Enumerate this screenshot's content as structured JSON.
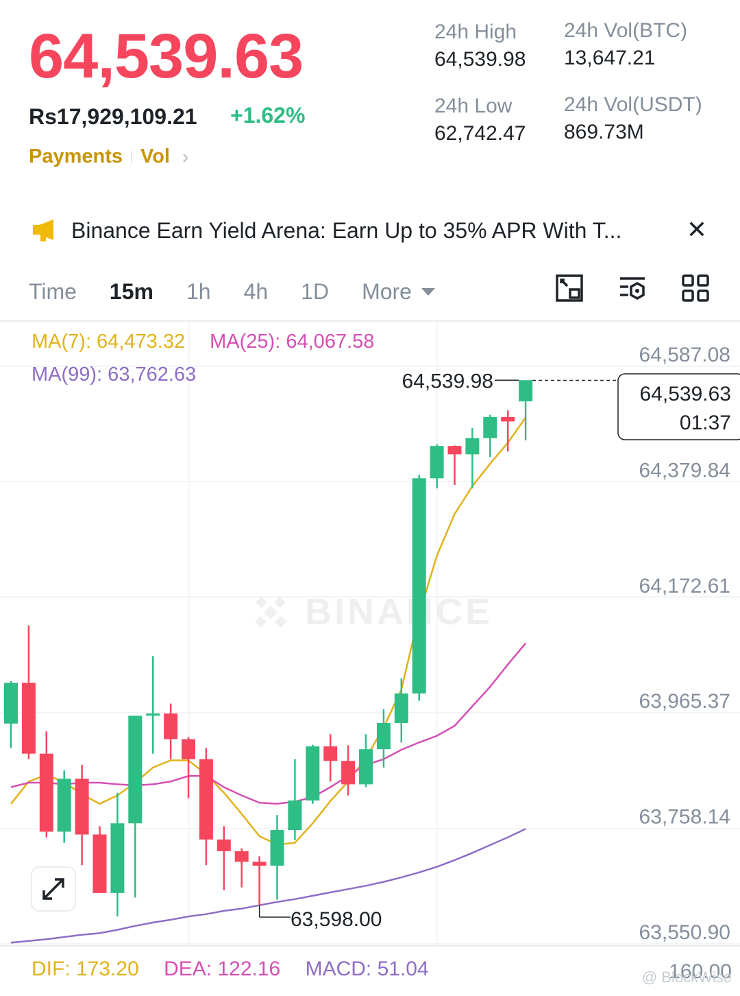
{
  "header": {
    "last_price": "64,539.63",
    "fiat_price": "Rs17,929,109.21",
    "change_pct": "+1.62%",
    "links": [
      "Payments",
      "Vol"
    ],
    "stats": [
      {
        "label": "24h High",
        "value": "64,539.98"
      },
      {
        "label": "24h Vol(BTC)",
        "value": "13,647.21"
      },
      {
        "label": "24h Low",
        "value": "62,742.47"
      },
      {
        "label": "24h Vol(USDT)",
        "value": "869.73M"
      }
    ]
  },
  "banner": {
    "text": "Binance Earn Yield Arena: Earn Up to 35% APR With T...",
    "icon": "megaphone-icon"
  },
  "timeframes": {
    "items": [
      "Time",
      "15m",
      "1h",
      "4h",
      "1D"
    ],
    "active": "15m",
    "more_label": "More"
  },
  "indicators": {
    "ma7": "MA(7): 64,473.32",
    "ma25": "MA(25): 64,067.58",
    "ma99": "MA(99): 63,762.63"
  },
  "chart_data": {
    "type": "candlestick",
    "interval": "15m",
    "y_ticks": [
      64587.08,
      64379.84,
      64172.61,
      63965.37,
      63758.14,
      63550.9
    ],
    "y_tick_labels": [
      "64,587.08",
      "64,379.84",
      "64,172.61",
      "63,965.37",
      "63,758.14",
      "63,550.90"
    ],
    "ylim": [
      63520,
      64650
    ],
    "grid": true,
    "current_price": "64,539.63",
    "countdown": "01:37",
    "high_marker": {
      "label": "64,539.98",
      "value": 64539.98
    },
    "low_marker": {
      "label": "63,598.00",
      "value": 63598.0
    },
    "candles": [
      {
        "open": 63924,
        "close": 63997,
        "high": 64000,
        "low": 63880
      },
      {
        "open": 63997,
        "close": 63870,
        "high": 64100,
        "low": 63860
      },
      {
        "open": 63870,
        "close": 63730,
        "high": 63910,
        "low": 63720
      },
      {
        "open": 63730,
        "close": 63825,
        "high": 63840,
        "low": 63710
      },
      {
        "open": 63825,
        "close": 63725,
        "high": 63850,
        "low": 63670
      },
      {
        "open": 63725,
        "close": 63620,
        "high": 63740,
        "low": 63620
      },
      {
        "open": 63620,
        "close": 63745,
        "high": 63800,
        "low": 63578
      },
      {
        "open": 63745,
        "close": 63938,
        "high": 63938,
        "low": 63612
      },
      {
        "open": 63938,
        "close": 63942,
        "high": 64045,
        "low": 63870
      },
      {
        "open": 63942,
        "close": 63896,
        "high": 63960,
        "low": 63860
      },
      {
        "open": 63896,
        "close": 63860,
        "high": 63900,
        "low": 63790
      },
      {
        "open": 63860,
        "close": 63716,
        "high": 63880,
        "low": 63670
      },
      {
        "open": 63716,
        "close": 63695,
        "high": 63740,
        "low": 63625
      },
      {
        "open": 63695,
        "close": 63676,
        "high": 63700,
        "low": 63630
      },
      {
        "open": 63676,
        "close": 63669,
        "high": 63686,
        "low": 63598
      },
      {
        "open": 63669,
        "close": 63733,
        "high": 63760,
        "low": 63608
      },
      {
        "open": 63733,
        "close": 63786,
        "high": 63860,
        "low": 63715
      },
      {
        "open": 63786,
        "close": 63883,
        "high": 63886,
        "low": 63780
      },
      {
        "open": 63883,
        "close": 63857,
        "high": 63905,
        "low": 63820
      },
      {
        "open": 63857,
        "close": 63815,
        "high": 63885,
        "low": 63795
      },
      {
        "open": 63815,
        "close": 63878,
        "high": 63905,
        "low": 63810
      },
      {
        "open": 63878,
        "close": 63925,
        "high": 63950,
        "low": 63845
      },
      {
        "open": 63925,
        "close": 63978,
        "high": 64005,
        "low": 63890
      },
      {
        "open": 63978,
        "close": 64364,
        "high": 64370,
        "low": 63965
      },
      {
        "open": 64364,
        "close": 64422,
        "high": 64425,
        "low": 64346
      },
      {
        "open": 64422,
        "close": 64407,
        "high": 64423,
        "low": 64352
      },
      {
        "open": 64407,
        "close": 64436,
        "high": 64454,
        "low": 64346
      },
      {
        "open": 64436,
        "close": 64474,
        "high": 64478,
        "low": 64402
      },
      {
        "open": 64474,
        "close": 64466,
        "high": 64486,
        "low": 64412
      },
      {
        "open": 64502,
        "close": 64540,
        "high": 64540,
        "low": 64432
      }
    ],
    "series": [
      {
        "name": "MA(7)",
        "color": "#e0b21b",
        "values": [
          63780,
          63820,
          63832,
          63819,
          63797,
          63780,
          63795,
          63818,
          63845,
          63858,
          63858,
          63833,
          63800,
          63762,
          63722,
          63707,
          63710,
          63745,
          63785,
          63820,
          63862,
          63917,
          63985,
          64120,
          64225,
          64300,
          64350,
          64390,
          64428,
          64473
        ]
      },
      {
        "name": "MA(25)",
        "color": "#d44fb3",
        "values": [
          63810,
          63818,
          63818,
          63815,
          63818,
          63818,
          63815,
          63813,
          63815,
          63820,
          63830,
          63830,
          63810,
          63795,
          63782,
          63780,
          63784,
          63792,
          63810,
          63830,
          63850,
          63860,
          63877,
          63890,
          63902,
          63920,
          63955,
          63990,
          64030,
          64068
        ]
      },
      {
        "name": "MA(99)",
        "color": "#8e6dc6",
        "values": [
          63531,
          63534,
          63537,
          63541,
          63545,
          63548,
          63554,
          63561,
          63567,
          63572,
          63578,
          63582,
          63588,
          63592,
          63598,
          63604,
          63609,
          63615,
          63621,
          63627,
          63633,
          63640,
          63648,
          63657,
          63667,
          63679,
          63692,
          63706,
          63720,
          63735
        ]
      }
    ]
  },
  "macd": {
    "dif": "DIF: 173.20",
    "dea": "DEA: 122.16",
    "macd": "MACD: 51.04",
    "axis_label": "160.00"
  },
  "watermark": {
    "chart_text": "BINANCE",
    "corner_text": "@ BlockWise"
  },
  "colors": {
    "up": "#2ebd85",
    "down": "#f6465d",
    "accent": "#c99400"
  }
}
